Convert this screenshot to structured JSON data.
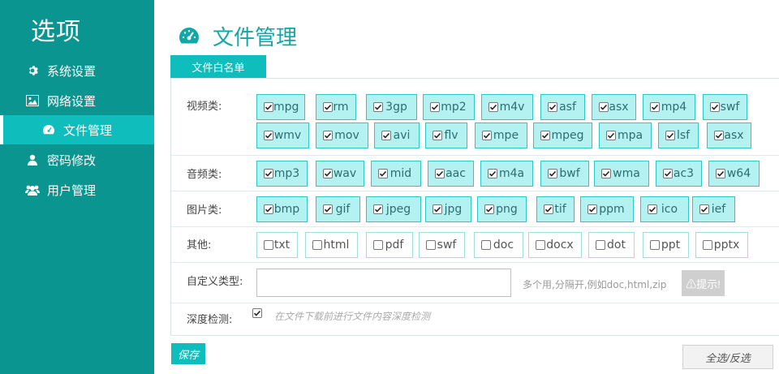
{
  "sidebar": {
    "title": "选项",
    "items": [
      {
        "label": "系统设置",
        "icon": "gear-icon"
      },
      {
        "label": "网络设置",
        "icon": "image-icon"
      },
      {
        "label": "文件管理",
        "icon": "dashboard-icon",
        "active": true
      },
      {
        "label": "密码修改",
        "icon": "user-icon"
      },
      {
        "label": "用户管理",
        "icon": "users-icon"
      }
    ]
  },
  "main": {
    "title": "文件管理",
    "tab": "文件白名单",
    "rows": {
      "video": {
        "label": "视频类:",
        "items": [
          "mpg",
          "rm",
          "3gp",
          "mp2",
          "m4v",
          "asf",
          "asx",
          "mp4",
          "swf",
          "wmv",
          "mov",
          "avi",
          "flv",
          "mpe",
          "mpeg",
          "mpa",
          "lsf",
          "asx"
        ],
        "checked": true
      },
      "audio": {
        "label": "音频类:",
        "items": [
          "mp3",
          "wav",
          "mid",
          "aac",
          "m4a",
          "bwf",
          "wma",
          "ac3",
          "w64"
        ],
        "checked": true
      },
      "image": {
        "label": "图片类:",
        "items": [
          "bmp",
          "gif",
          "jpeg",
          "jpg",
          "png",
          "tif",
          "ppm",
          "ico",
          "ief"
        ],
        "checked": true
      },
      "other": {
        "label": "其他:",
        "items": [
          "txt",
          "html",
          "pdf",
          "swf",
          "doc",
          "docx",
          "dot",
          "ppt",
          "pptx"
        ],
        "checked": false
      }
    },
    "custom": {
      "label": "自定义类型:",
      "value": "",
      "hint": "多个用,分隔开,例如doc,html,zip",
      "hint_button": "⚠提示!"
    },
    "deep": {
      "label": "深度检测:",
      "checked": true,
      "description": "在文件下载前进行文件内容深度检测"
    },
    "save_label": "保存",
    "select_all_label": "全选/反选"
  },
  "colors": {
    "sidebar_bg": "#0b9590",
    "accent": "#0fbdbd",
    "checked_bg": "#b4f2f2"
  }
}
